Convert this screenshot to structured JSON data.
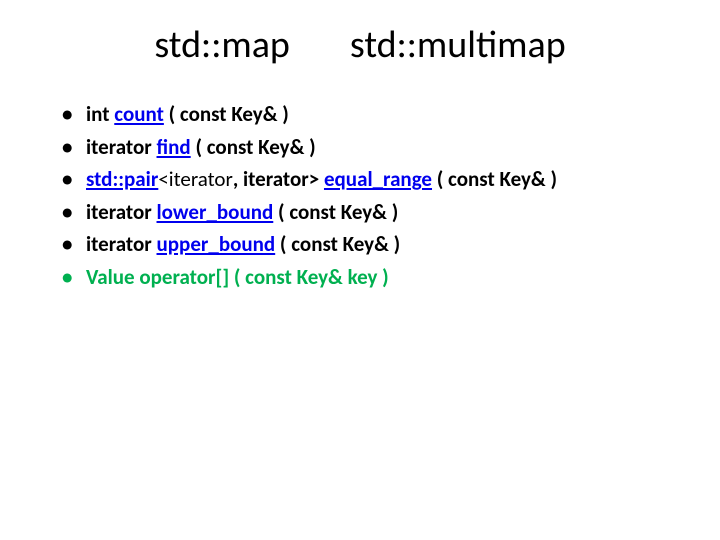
{
  "title": {
    "left": "std::map",
    "right": "std::multimap"
  },
  "items": [
    {
      "pre": "int ",
      "link": "count",
      "post": " ( const Key&  )"
    },
    {
      "pre": "iterator ",
      "link": "find",
      "post": " ( const Key& )"
    },
    {
      "stdpair_link": "std::pair",
      "tpl_open": "<iterator",
      "tpl_mid": ", iterator> ",
      "link": "equal_range",
      "post": " ( const Key& )"
    },
    {
      "pre": "iterator ",
      "link": "lower_bound",
      "post": " ( const Key& )"
    },
    {
      "pre": "iterator ",
      "link": "upper_bound",
      "post": " ( const Key& )"
    },
    {
      "green_text": "Value operator[] ( const Key& key )"
    }
  ]
}
